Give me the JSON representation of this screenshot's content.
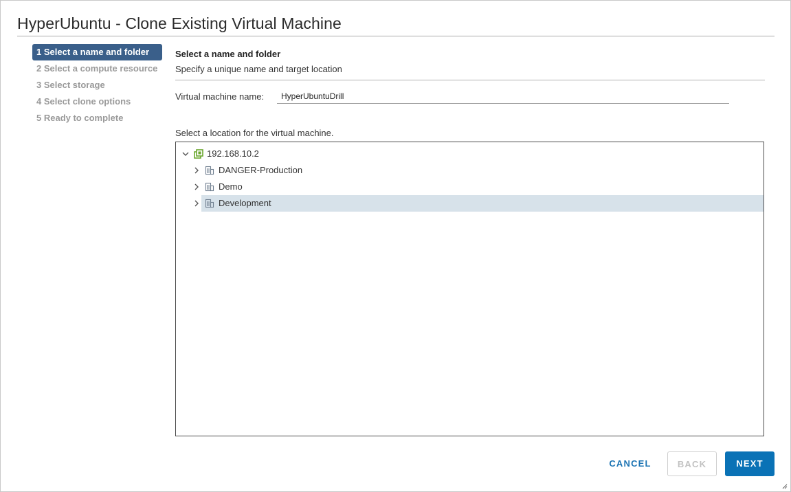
{
  "window": {
    "title": "HyperUbuntu - Clone Existing Virtual Machine"
  },
  "steps": [
    {
      "label": "1 Select a name and folder",
      "active": true
    },
    {
      "label": "2 Select a compute resource",
      "active": false
    },
    {
      "label": "3 Select storage",
      "active": false
    },
    {
      "label": "4 Select clone options",
      "active": false
    },
    {
      "label": "5 Ready to complete",
      "active": false
    }
  ],
  "main": {
    "section_title": "Select a name and folder",
    "section_subtitle": "Specify a unique name and target location",
    "vm_name_label": "Virtual machine name:",
    "vm_name_value": "HyperUbuntuDrill",
    "location_label": "Select a location for the virtual machine."
  },
  "tree": {
    "root": {
      "label": "192.168.10.2",
      "icon": "vcenter-icon",
      "expanded": true
    },
    "children": [
      {
        "label": "DANGER-Production",
        "icon": "datacenter-icon",
        "selected": false
      },
      {
        "label": "Demo",
        "icon": "datacenter-icon",
        "selected": false
      },
      {
        "label": "Development",
        "icon": "datacenter-icon",
        "selected": true
      }
    ]
  },
  "buttons": {
    "cancel": "CANCEL",
    "back": "BACK",
    "next": "NEXT"
  },
  "colors": {
    "active_step_bg": "#3a5f8a",
    "primary_button": "#0a72b6",
    "selected_row": "#d7e2ea",
    "vcenter_icon": "#6aa62e"
  }
}
